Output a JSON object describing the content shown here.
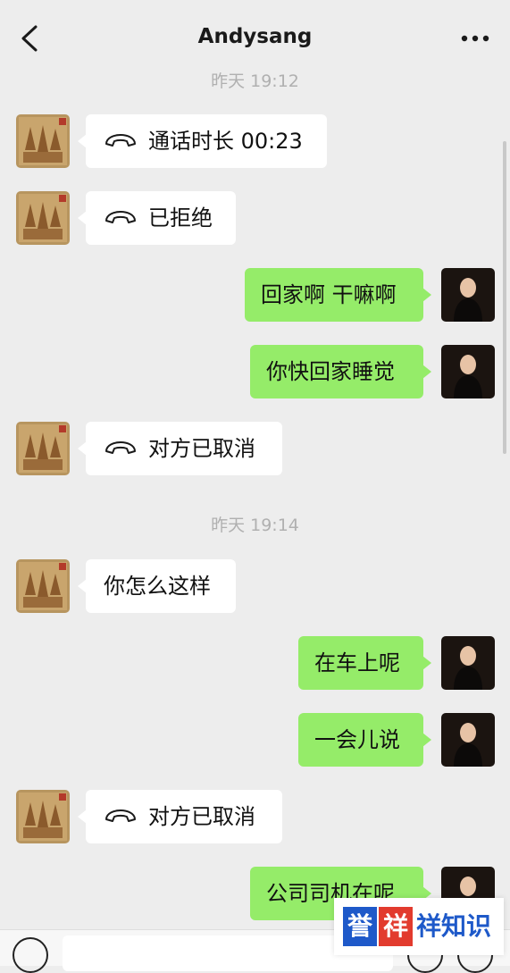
{
  "header": {
    "title": "Andysang"
  },
  "messages": {
    "t1": "昨天 19:12",
    "m1": "通话时长 00:23",
    "m2": "已拒绝",
    "m3": "回家啊 干嘛啊",
    "m4": "你快回家睡觉",
    "m5": "对方已取消",
    "t2": "昨天 19:14",
    "m6": "你怎么这样",
    "m7": "在车上呢",
    "m8": "一会儿说",
    "m9": "对方已取消",
    "m10": "公司司机在呢"
  },
  "watermark": {
    "box1": "誉",
    "box2": "祥",
    "rest": "祥知识"
  },
  "colors": {
    "background": "#ededed",
    "sent_bubble": "#95ec69",
    "received_bubble": "#ffffff"
  },
  "icons": [
    "back-arrow-icon",
    "more-dots-icon",
    "phone-hangup-icon",
    "voice-icon",
    "emoji-icon",
    "plus-icon"
  ]
}
